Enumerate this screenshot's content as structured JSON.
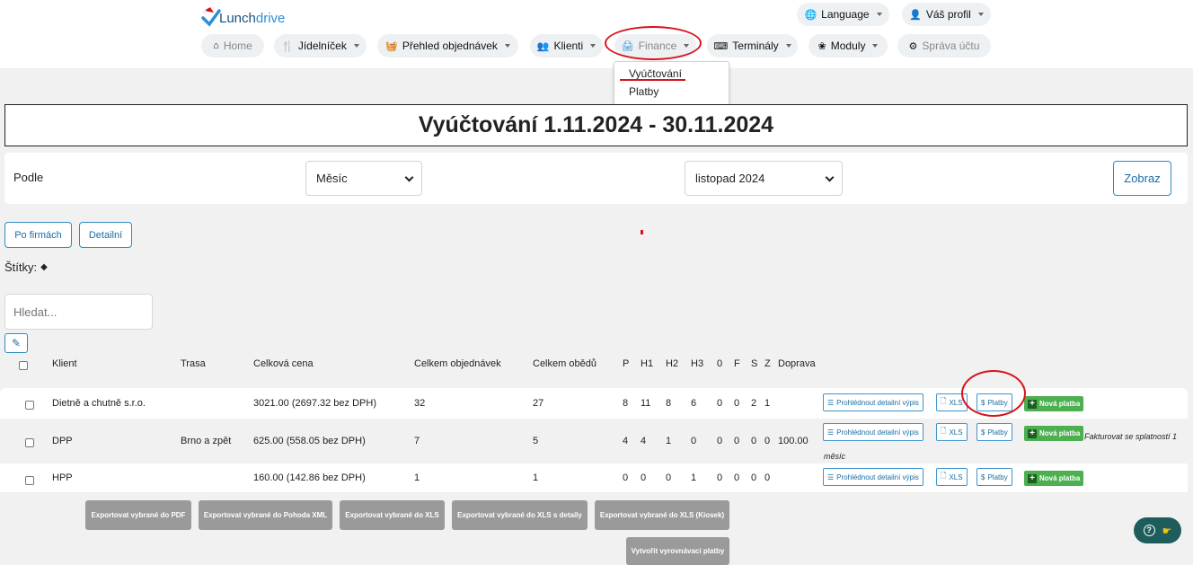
{
  "brand": {
    "name": "Lunch",
    "name_accent": "drive"
  },
  "nav": {
    "top": {
      "language": "Language",
      "profile": "Váš profil"
    },
    "items": [
      {
        "label": "Home",
        "icon": "home-icon"
      },
      {
        "label": "Jídelníček",
        "icon": "fork-knife-icon"
      },
      {
        "label": "Přehled objednávek",
        "icon": "basket-icon"
      },
      {
        "label": "Klienti",
        "icon": "users-icon"
      },
      {
        "label": "Finance",
        "icon": "cash-register-icon"
      },
      {
        "label": "Terminály",
        "icon": "terminal-icon"
      },
      {
        "label": "Moduly",
        "icon": "modules-icon"
      },
      {
        "label": "Správa účtu",
        "icon": "gear-icon"
      }
    ],
    "finance_menu": [
      "Vyúčtování",
      "Platby"
    ]
  },
  "page_title": "Vyúčtování 1.11.2024 - 30.11.2024",
  "filter": {
    "label": "Podle",
    "period_type": "Měsíc",
    "period": "listopad 2024",
    "submit": "Zobraz"
  },
  "view_buttons": [
    "Po firmách",
    "Detailní"
  ],
  "tags_label": "Štítky:",
  "search_placeholder": "Hledat...",
  "table": {
    "headers": [
      "Klient",
      "Trasa",
      "Celková cena",
      "Celkem objednávek",
      "Celkem obědů",
      "P",
      "H1",
      "H2",
      "H3",
      "0",
      "F",
      "S",
      "Z",
      "Doprava"
    ],
    "rows": [
      {
        "client": "Dietně a chutně s.r.o.",
        "route": "",
        "price": "3021.00 (2697.32 bez DPH)",
        "orders": "32",
        "meals": "27",
        "p": "8",
        "h1": "11",
        "h2": "8",
        "h3": "6",
        "c0": "0",
        "f": "0",
        "s": "2",
        "z": "1",
        "transport": "",
        "note": ""
      },
      {
        "client": "DPP",
        "route": "Brno a zpět",
        "price": "625.00 (558.05 bez DPH)",
        "orders": "7",
        "meals": "5",
        "p": "4",
        "h1": "4",
        "h2": "1",
        "h3": "0",
        "c0": "0",
        "f": "0",
        "s": "0",
        "z": "0",
        "transport": "100.00",
        "note": "Fakturovat se splatností 1 měsíc"
      },
      {
        "client": "HPP",
        "route": "",
        "price": "160.00 (142.86 bez DPH)",
        "orders": "1",
        "meals": "1",
        "p": "0",
        "h1": "0",
        "h2": "0",
        "h3": "1",
        "c0": "0",
        "f": "0",
        "s": "0",
        "z": "0",
        "transport": "",
        "note": ""
      }
    ],
    "actions": {
      "detail": "Prohlédnout detailní výpis",
      "xls": "XLS",
      "payments": "Platby",
      "new_payment": "Nová platba"
    }
  },
  "export_buttons": [
    "Exportovat vybrané do PDF",
    "Exportovat vybrané do Pohoda XML",
    "Exportovat vybrané do XLS",
    "Exportovat vybrané do XLS s detaily",
    "Exportovat vybrané do XLS (Kiosek)",
    "Vytvořit vyrovnávací platby"
  ],
  "colors": {
    "accent": "#2e8bc0",
    "success": "#4caf50",
    "annotation": "#d8131b",
    "help": "#1f5c5c"
  }
}
